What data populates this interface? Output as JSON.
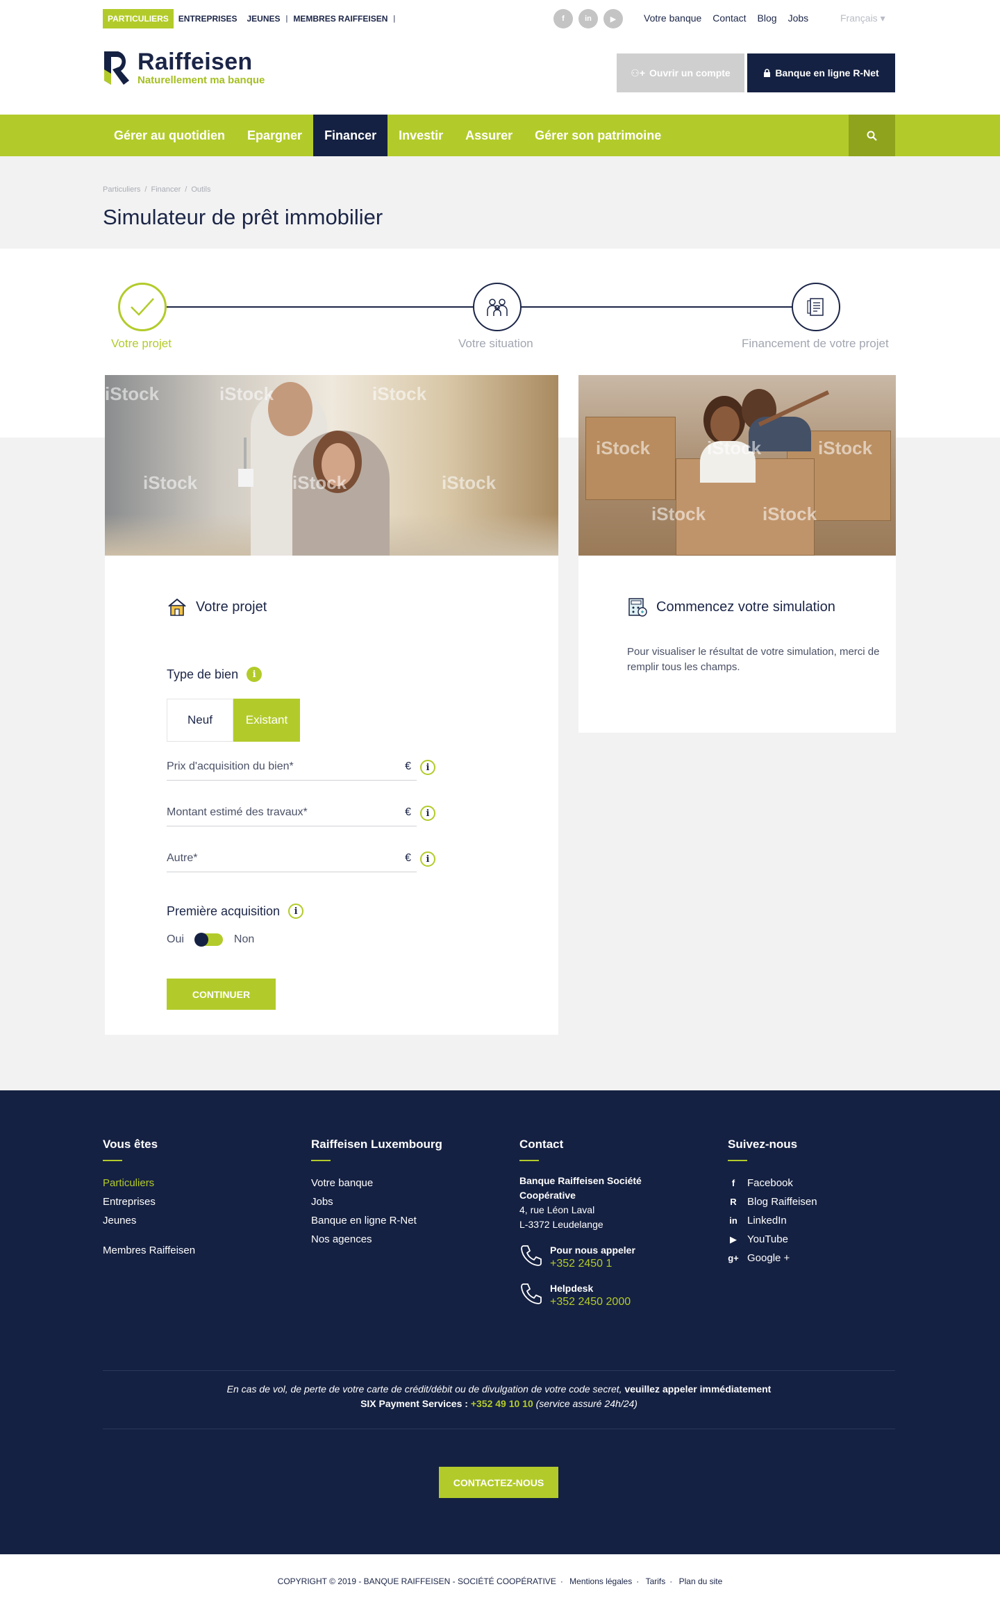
{
  "topbar": {
    "segments": [
      {
        "label": "PARTICULIERS",
        "active": true
      },
      {
        "label": "ENTREPRISES",
        "active": false
      },
      {
        "label": "JEUNES",
        "active": false
      },
      {
        "label": "MEMBRES RAIFFEISEN",
        "active": false
      }
    ],
    "social_icons": [
      "facebook-icon",
      "linkedin-icon",
      "youtube-icon"
    ],
    "links": [
      "Votre banque",
      "Contact",
      "Blog",
      "Jobs"
    ],
    "language": "Français"
  },
  "brand": {
    "name": "Raiffeisen",
    "tagline": "Naturellement ma banque",
    "colors": {
      "green": "#b3cb2a",
      "navy": "#152142",
      "gray": "#f2f2f2"
    }
  },
  "header_buttons": {
    "open_account": "Ouvrir un compte",
    "rnet": "Banque en ligne R-Net"
  },
  "nav": {
    "items": [
      {
        "label": "Gérer au quotidien",
        "active": false
      },
      {
        "label": "Epargner",
        "active": false
      },
      {
        "label": "Financer",
        "active": true
      },
      {
        "label": "Investir",
        "active": false
      },
      {
        "label": "Assurer",
        "active": false
      },
      {
        "label": "Gérer son patrimoine",
        "active": false
      }
    ],
    "search_icon": "search-icon"
  },
  "breadcrumb": [
    "Particuliers",
    "Financer",
    "Outils"
  ],
  "page_title": "Simulateur de prêt immobilier",
  "steps": [
    {
      "label": "Votre projet",
      "status": "done",
      "icon": "check-icon"
    },
    {
      "label": "Votre situation",
      "status": "todo",
      "icon": "family-icon"
    },
    {
      "label": "Financement de votre projet",
      "status": "todo",
      "icon": "document-icon"
    }
  ],
  "form": {
    "section_title": "Votre projet",
    "section_icon": "house-icon",
    "property_type_label": "Type de bien",
    "property_type_options": [
      "Neuf",
      "Existant"
    ],
    "property_type_selected": "Existant",
    "fields": [
      {
        "placeholder": "Prix d'acquisition du bien*",
        "unit": "€"
      },
      {
        "placeholder": "Montant estimé des travaux*",
        "unit": "€"
      },
      {
        "placeholder": "Autre*",
        "unit": "€"
      }
    ],
    "first_acquisition_label": "Première acquisition",
    "switch_yes": "Oui",
    "switch_no": "Non",
    "continue_label": "CONTINUER"
  },
  "result": {
    "title": "Commencez votre simulation",
    "icon": "calculator-icon",
    "text": "Pour visualiser le résultat de votre simulation, merci de remplir tous les champs."
  },
  "footer": {
    "col1": {
      "title": "Vous êtes",
      "links": [
        "Particuliers",
        "Entreprises",
        "Jeunes"
      ],
      "extra": "Membres Raiffeisen"
    },
    "col2": {
      "title": "Raiffeisen Luxembourg",
      "links": [
        "Votre banque",
        "Jobs",
        "Banque en ligne R-Net",
        "Nos agences"
      ]
    },
    "col3": {
      "title": "Contact",
      "company_line1": "Banque Raiffeisen Société",
      "company_line2": "Coopérative",
      "address1": "4, rue Léon Laval",
      "address2": "L-3372 Leudelange",
      "call_label": "Pour nous appeler",
      "call_number": "+352 2450 1",
      "helpdesk_label": "Helpdesk",
      "helpdesk_number": "+352 2450 2000"
    },
    "col4": {
      "title": "Suivez-nous",
      "links": [
        {
          "label": "Facebook",
          "icon": "facebook-icon"
        },
        {
          "label": "Blog Raiffeisen",
          "icon": "raiffeisen-icon"
        },
        {
          "label": "LinkedIn",
          "icon": "linkedin-icon"
        },
        {
          "label": "YouTube",
          "icon": "youtube-icon"
        },
        {
          "label": "Google +",
          "icon": "googleplus-icon"
        }
      ]
    },
    "warning_part1": "En cas de vol, de perte de votre carte de crédit/débit ou de divulgation de votre code secret,",
    "warning_part2": "veuillez appeler immédiatement",
    "warning_part3": "SIX Payment Services :",
    "warning_phone": "+352 49 10 10",
    "warning_part4": "(service assuré 24h/24)",
    "contact_button": "CONTACTEZ-NOUS"
  },
  "copyright": {
    "text": "COPYRIGHT © 2019 - BANQUE RAIFFEISEN - SOCIÉTÉ COOPÉRATIVE",
    "links": [
      "Mentions légales",
      "Tarifs",
      "Plan du site"
    ]
  },
  "photo_watermark": "iStock"
}
